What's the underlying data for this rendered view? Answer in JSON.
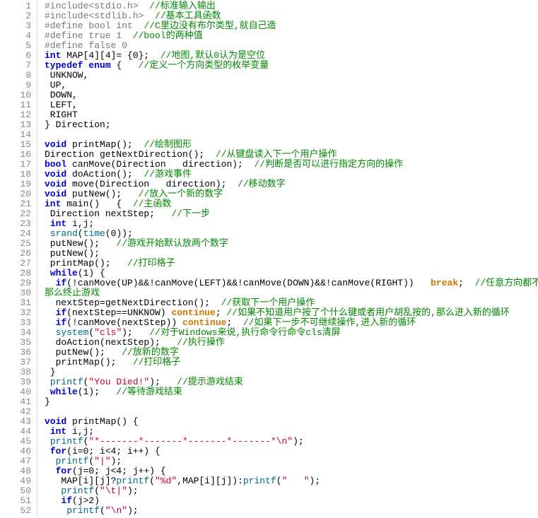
{
  "lines": [
    {
      "n": 1,
      "tokens": [
        [
          "pp",
          "#include<stdio.h>  "
        ],
        [
          "cmt",
          "//标准输入输出"
        ]
      ]
    },
    {
      "n": 2,
      "tokens": [
        [
          "pp",
          "#include<stdlib.h>  "
        ],
        [
          "cmt",
          "//基本工具函数"
        ]
      ]
    },
    {
      "n": 3,
      "tokens": [
        [
          "pp",
          "#define bool int  "
        ],
        [
          "cmt",
          "//C里边没有布尔类型,就自己造"
        ]
      ]
    },
    {
      "n": 4,
      "tokens": [
        [
          "pp",
          "#define true 1  "
        ],
        [
          "cmt",
          "//bool的两种值"
        ]
      ]
    },
    {
      "n": 5,
      "tokens": [
        [
          "pp",
          "#define false 0"
        ]
      ]
    },
    {
      "n": 6,
      "tokens": [
        [
          "kw",
          "int"
        ],
        [
          "id",
          " MAP[4][4]= {0};  "
        ],
        [
          "cmt",
          "//地图,默认0认为是空位"
        ]
      ]
    },
    {
      "n": 7,
      "tokens": [
        [
          "kw",
          "typedef"
        ],
        [
          "id",
          " "
        ],
        [
          "kw",
          "enum"
        ],
        [
          "id",
          " {   "
        ],
        [
          "cmt",
          "//定义一个方向类型的枚举变量"
        ]
      ]
    },
    {
      "n": 8,
      "tokens": [
        [
          "id",
          " UNKNOW,"
        ]
      ]
    },
    {
      "n": 9,
      "tokens": [
        [
          "id",
          " UP,"
        ]
      ]
    },
    {
      "n": 10,
      "tokens": [
        [
          "id",
          " DOWN,"
        ]
      ]
    },
    {
      "n": 11,
      "tokens": [
        [
          "id",
          " LEFT,"
        ]
      ]
    },
    {
      "n": 12,
      "tokens": [
        [
          "id",
          " RIGHT"
        ]
      ]
    },
    {
      "n": 13,
      "tokens": [
        [
          "id",
          "} Direction;"
        ]
      ]
    },
    {
      "n": 14,
      "tokens": [
        [
          "id",
          ""
        ]
      ]
    },
    {
      "n": 15,
      "tokens": [
        [
          "kw",
          "void"
        ],
        [
          "id",
          " printMap();  "
        ],
        [
          "cmt",
          "//绘制图形"
        ]
      ]
    },
    {
      "n": 16,
      "tokens": [
        [
          "id",
          "Direction getNextDirection();  "
        ],
        [
          "cmt",
          "//从键盘读入下一个用户操作"
        ]
      ]
    },
    {
      "n": 17,
      "tokens": [
        [
          "kw",
          "bool"
        ],
        [
          "id",
          " canMove(Direction   direction);  "
        ],
        [
          "cmt",
          "//判断是否可以进行指定方向的操作"
        ]
      ]
    },
    {
      "n": 18,
      "tokens": [
        [
          "kw",
          "void"
        ],
        [
          "id",
          " doAction();  "
        ],
        [
          "cmt",
          "//游戏事件"
        ]
      ]
    },
    {
      "n": 19,
      "tokens": [
        [
          "kw",
          "void"
        ],
        [
          "id",
          " move(Direction   direction);  "
        ],
        [
          "cmt",
          "//移动数字"
        ]
      ]
    },
    {
      "n": 20,
      "tokens": [
        [
          "kw",
          "void"
        ],
        [
          "id",
          " putNew();   "
        ],
        [
          "cmt",
          "//放入一个新的数字"
        ]
      ]
    },
    {
      "n": 21,
      "tokens": [
        [
          "kw",
          "int"
        ],
        [
          "id",
          " main()   {  "
        ],
        [
          "cmt",
          "//主函数"
        ]
      ]
    },
    {
      "n": 22,
      "tokens": [
        [
          "id",
          " Direction nextStep;   "
        ],
        [
          "cmt",
          "//下一步"
        ]
      ]
    },
    {
      "n": 23,
      "tokens": [
        [
          "id",
          " "
        ],
        [
          "kw",
          "int"
        ],
        [
          "id",
          " i,j;"
        ]
      ]
    },
    {
      "n": 24,
      "tokens": [
        [
          "id",
          " "
        ],
        [
          "func-call",
          "srand"
        ],
        [
          "id",
          "("
        ],
        [
          "func-call",
          "time"
        ],
        [
          "id",
          "(0));"
        ]
      ]
    },
    {
      "n": 25,
      "tokens": [
        [
          "id",
          " putNew();   "
        ],
        [
          "cmt",
          "//游戏开始默认放两个数字"
        ]
      ]
    },
    {
      "n": 26,
      "tokens": [
        [
          "id",
          " putNew();"
        ]
      ]
    },
    {
      "n": 27,
      "tokens": [
        [
          "id",
          " printMap();   "
        ],
        [
          "cmt",
          "//打印格子"
        ]
      ]
    },
    {
      "n": 28,
      "tokens": [
        [
          "id",
          " "
        ],
        [
          "kw",
          "while"
        ],
        [
          "id",
          "(1) {"
        ]
      ]
    },
    {
      "n": 29,
      "tokens": [
        [
          "id",
          "  "
        ],
        [
          "kw",
          "if"
        ],
        [
          "id",
          "(!canMove(UP)&&!canMove(LEFT)&&!canMove(DOWN)&&!canMove(RIGHT))   "
        ],
        [
          "brk",
          "break"
        ],
        [
          "id",
          ";  "
        ],
        [
          "cmt",
          "//任意方向都不能移动,"
        ]
      ]
    },
    {
      "n": 30,
      "tokens": [
        [
          "cmt",
          "那么终止游戏"
        ]
      ]
    },
    {
      "n": 31,
      "tokens": [
        [
          "id",
          "  nextStep=getNextDirection();  "
        ],
        [
          "cmt",
          "//获取下一个用户操作"
        ]
      ]
    },
    {
      "n": 32,
      "tokens": [
        [
          "id",
          "  "
        ],
        [
          "kw",
          "if"
        ],
        [
          "id",
          "(nextStep==UNKNOW) "
        ],
        [
          "brk",
          "continue"
        ],
        [
          "id",
          "; "
        ],
        [
          "cmt",
          "//如果不知道用户按了个什么键或者用户胡乱按的,那么进入新的循环"
        ]
      ]
    },
    {
      "n": 33,
      "tokens": [
        [
          "id",
          "  "
        ],
        [
          "kw",
          "if"
        ],
        [
          "id",
          "(!canMove(nextStep)) "
        ],
        [
          "brk",
          "continue"
        ],
        [
          "id",
          ";  "
        ],
        [
          "cmt",
          "//如果下一步不可继续操作,进入新的循环"
        ]
      ]
    },
    {
      "n": 34,
      "tokens": [
        [
          "id",
          "  "
        ],
        [
          "func-call",
          "system"
        ],
        [
          "id",
          "("
        ],
        [
          "str",
          "\"cls\""
        ],
        [
          "id",
          ");   "
        ],
        [
          "cmt",
          "//对于Windows来说,执行命令行命令cls清屏"
        ]
      ]
    },
    {
      "n": 35,
      "tokens": [
        [
          "id",
          "  doAction(nextStep);   "
        ],
        [
          "cmt",
          "//执行操作"
        ]
      ]
    },
    {
      "n": 36,
      "tokens": [
        [
          "id",
          "  putNew();   "
        ],
        [
          "cmt",
          "//放新的数字"
        ]
      ]
    },
    {
      "n": 37,
      "tokens": [
        [
          "id",
          "  printMap();   "
        ],
        [
          "cmt",
          "//打印格子"
        ]
      ]
    },
    {
      "n": 38,
      "tokens": [
        [
          "id",
          " }"
        ]
      ]
    },
    {
      "n": 39,
      "tokens": [
        [
          "id",
          " "
        ],
        [
          "func-call",
          "printf"
        ],
        [
          "id",
          "("
        ],
        [
          "str",
          "\"You Died!\""
        ],
        [
          "id",
          ");   "
        ],
        [
          "cmt",
          "//提示游戏结束"
        ]
      ]
    },
    {
      "n": 40,
      "tokens": [
        [
          "id",
          " "
        ],
        [
          "kw",
          "while"
        ],
        [
          "id",
          "(1);   "
        ],
        [
          "cmt",
          "//等待游戏结束"
        ]
      ]
    },
    {
      "n": 41,
      "tokens": [
        [
          "id",
          "}"
        ]
      ]
    },
    {
      "n": 42,
      "tokens": [
        [
          "id",
          ""
        ]
      ]
    },
    {
      "n": 43,
      "tokens": [
        [
          "kw",
          "void"
        ],
        [
          "id",
          " printMap() {"
        ]
      ]
    },
    {
      "n": 44,
      "tokens": [
        [
          "id",
          " "
        ],
        [
          "kw",
          "int"
        ],
        [
          "id",
          " i,j;"
        ]
      ]
    },
    {
      "n": 45,
      "tokens": [
        [
          "id",
          " "
        ],
        [
          "func-call",
          "printf"
        ],
        [
          "id",
          "("
        ],
        [
          "str",
          "\"*-------*-------*-------*-------*\\n\""
        ],
        [
          "id",
          ");"
        ]
      ]
    },
    {
      "n": 46,
      "tokens": [
        [
          "id",
          " "
        ],
        [
          "kw",
          "for"
        ],
        [
          "id",
          "(i=0; i<4; i++) {"
        ]
      ]
    },
    {
      "n": 47,
      "tokens": [
        [
          "id",
          "  "
        ],
        [
          "func-call",
          "printf"
        ],
        [
          "id",
          "("
        ],
        [
          "str",
          "\"|\""
        ],
        [
          "id",
          ");"
        ]
      ]
    },
    {
      "n": 48,
      "tokens": [
        [
          "id",
          "  "
        ],
        [
          "kw",
          "for"
        ],
        [
          "id",
          "(j=0; j<4; j++) {"
        ]
      ]
    },
    {
      "n": 49,
      "tokens": [
        [
          "id",
          "   MAP[i][j]?"
        ],
        [
          "func-call",
          "printf"
        ],
        [
          "id",
          "("
        ],
        [
          "str",
          "\"%d\""
        ],
        [
          "id",
          ",MAP[i][j]):"
        ],
        [
          "func-call",
          "printf"
        ],
        [
          "id",
          "("
        ],
        [
          "str",
          "\"   \""
        ],
        [
          "id",
          ");"
        ]
      ]
    },
    {
      "n": 50,
      "tokens": [
        [
          "id",
          "   "
        ],
        [
          "func-call",
          "printf"
        ],
        [
          "id",
          "("
        ],
        [
          "str",
          "\"\\t|\""
        ],
        [
          "id",
          ");"
        ]
      ]
    },
    {
      "n": 51,
      "tokens": [
        [
          "id",
          "   "
        ],
        [
          "kw",
          "if"
        ],
        [
          "id",
          "(j>2)"
        ]
      ]
    },
    {
      "n": 52,
      "tokens": [
        [
          "id",
          "    "
        ],
        [
          "func-call",
          "printf"
        ],
        [
          "id",
          "("
        ],
        [
          "str",
          "\"\\n\""
        ],
        [
          "id",
          ");"
        ]
      ]
    }
  ]
}
